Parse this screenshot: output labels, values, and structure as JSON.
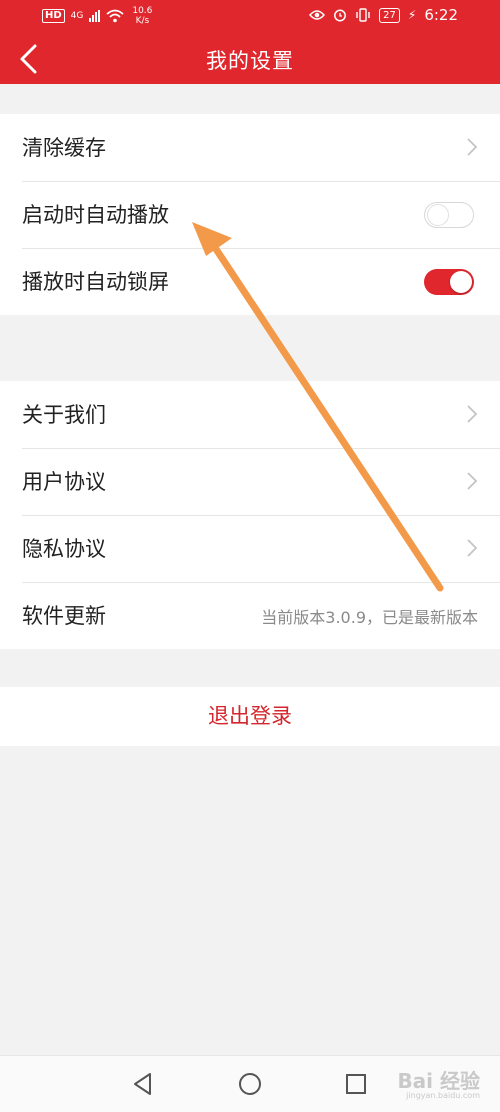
{
  "status_bar": {
    "hd": "HD",
    "net": "4G",
    "speed_value": "10.6",
    "speed_unit": "K/s",
    "battery": "27",
    "time": "6:22"
  },
  "header": {
    "title": "我的设置"
  },
  "group1": {
    "clear_cache": "清除缓存",
    "autoplay": "启动时自动播放",
    "autolock": "播放时自动锁屏",
    "autoplay_enabled": false,
    "autolock_enabled": true
  },
  "group2": {
    "about": "关于我们",
    "user_agreement": "用户协议",
    "privacy": "隐私协议",
    "update": "软件更新",
    "version_info": "当前版本3.0.9，已是最新版本"
  },
  "logout": "退出登录",
  "watermark": {
    "main": "Bai 经验",
    "sub": "jingyan.baidu.com"
  },
  "colors": {
    "accent": "#e0272d",
    "annotation_arrow": "#f39a4a"
  }
}
